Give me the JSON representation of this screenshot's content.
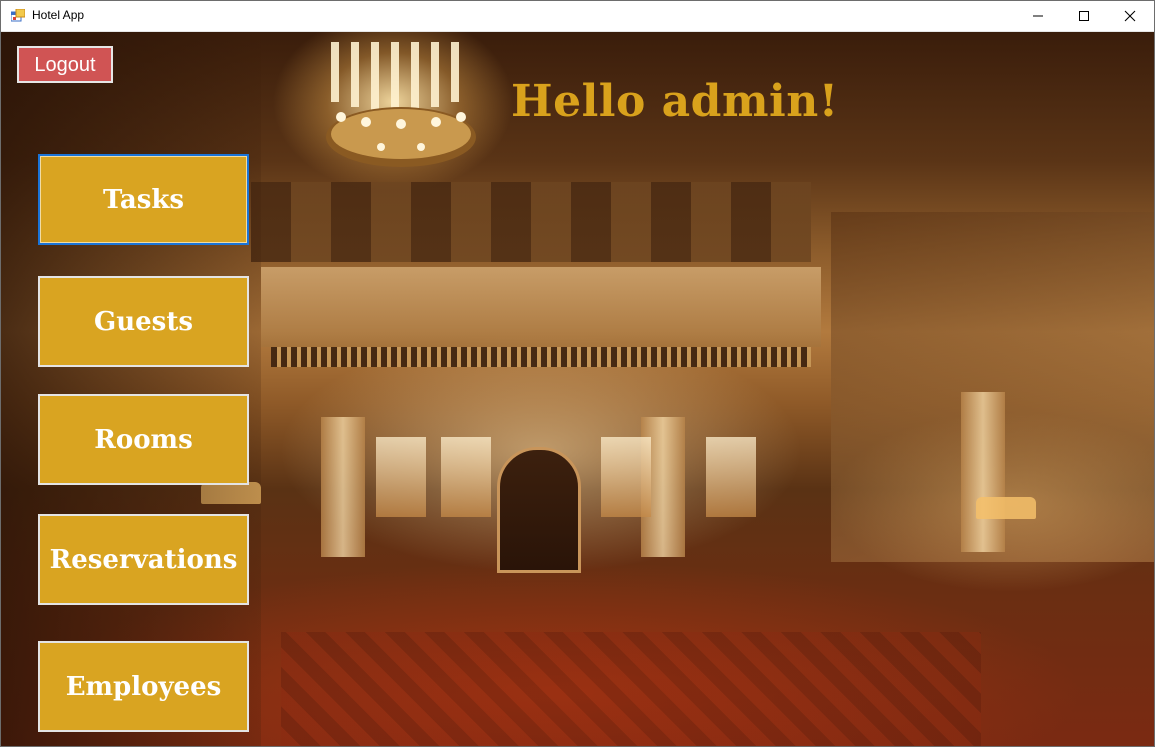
{
  "window": {
    "title": "Hotel App",
    "controls": {
      "minimize": "minimize-icon",
      "maximize": "maximize-icon",
      "close": "close-icon"
    }
  },
  "header": {
    "logout_label": "Logout",
    "greeting": "Hello admin!"
  },
  "nav": {
    "items": [
      {
        "label": "Tasks",
        "focused": true
      },
      {
        "label": "Guests",
        "focused": false
      },
      {
        "label": "Rooms",
        "focused": false
      },
      {
        "label": "Reservations",
        "focused": false
      },
      {
        "label": "Employees",
        "focused": false
      }
    ]
  },
  "colors": {
    "accent_gold": "#d9a421",
    "greeting_gold": "#d9a21c",
    "logout_red": "#d05454",
    "focus_blue": "#1a74d8"
  }
}
